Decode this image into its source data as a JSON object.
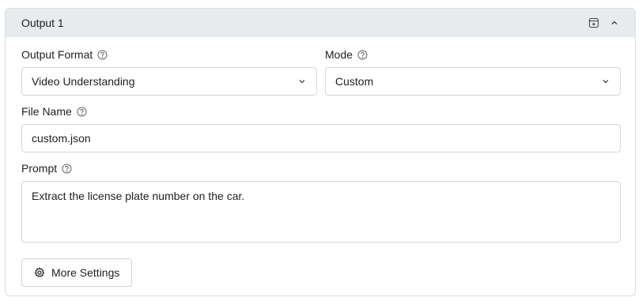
{
  "panel": {
    "title": "Output 1",
    "icons": [
      "archive-add-icon",
      "chevron-up-icon"
    ]
  },
  "output_format": {
    "label": "Output Format",
    "value": "Video Understanding"
  },
  "mode": {
    "label": "Mode",
    "value": "Custom"
  },
  "file_name": {
    "label": "File Name",
    "value": "custom.json"
  },
  "prompt": {
    "label": "Prompt",
    "value": "Extract the license plate number on the car."
  },
  "more_settings": {
    "label": "More Settings",
    "icon": "gear-icon"
  },
  "colors": {
    "header_bg": "#e8ebee",
    "border": "#d4d7db",
    "text": "#1f1f1f"
  }
}
